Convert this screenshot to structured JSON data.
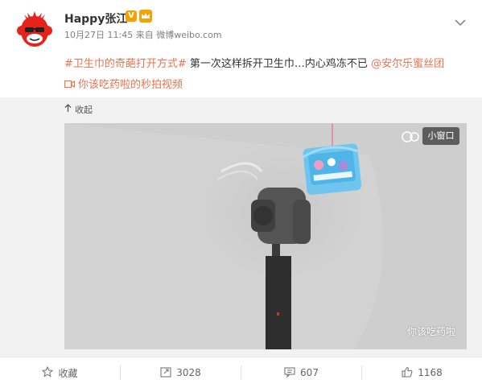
{
  "post": {
    "username": "Happy张江",
    "verified_badge": "V",
    "timestamp": "10月27日 11:45",
    "source": "来自 微博weibo.com",
    "hashtag": "#卫生巾的奇葩打开方式#",
    "text": " 第一次这样拆开卫生巾…内心鸡冻不已 ",
    "mention": "@安尔乐蜜丝团",
    "video_link": "你该吃药啦的秒拍视频"
  },
  "media": {
    "collapse_label": "收起",
    "small_window_label": "小窗口",
    "watermark": "你该吃药啦"
  },
  "footer": {
    "favorite_label": "收藏",
    "repost_count": "3028",
    "comment_count": "607",
    "like_count": "1168"
  },
  "icons": {
    "avatar": "monkey-avatar-icon",
    "member": "crown-member-icon",
    "menu": "chevron-down-icon",
    "video": "video-icon",
    "collapse": "arrow-up-icon",
    "favorite": "star-icon",
    "repost": "repost-icon",
    "comment": "comment-icon",
    "like": "thumbs-up-icon"
  },
  "colors": {
    "link": "#eb7350",
    "verified": "#f7a000",
    "avatar_red": "#e5231a"
  }
}
